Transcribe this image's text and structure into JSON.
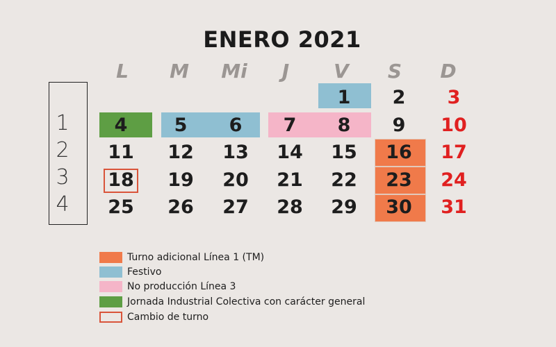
{
  "title": "ENERO 2021",
  "day_headers": [
    "L",
    "M",
    "Mi",
    "J",
    "V",
    "S",
    "D"
  ],
  "week_numbers": [
    "1",
    "2",
    "3",
    "4"
  ],
  "rows": [
    [
      "",
      "",
      "",
      "",
      "1",
      "2",
      "3"
    ],
    [
      "4",
      "5",
      "6",
      "7",
      "8",
      "9",
      "10"
    ],
    [
      "11",
      "12",
      "13",
      "14",
      "15",
      "16",
      "17"
    ],
    [
      "18",
      "19",
      "20",
      "21",
      "22",
      "23",
      "24"
    ],
    [
      "25",
      "26",
      "27",
      "28",
      "29",
      "30",
      "31"
    ]
  ],
  "legend": [
    {
      "label": "Turno adicional Línea 1 (TM)",
      "color": "#f07a4a"
    },
    {
      "label": "Festivo",
      "color": "#8fbfd2"
    },
    {
      "label": "No producción Línea 3",
      "color": "#f5b5c8"
    },
    {
      "label": "Jornada Industrial Colectiva con carácter general",
      "color": "#5e9e44"
    },
    {
      "label": "Cambio de turno",
      "color": "#d9543a"
    }
  ],
  "colors": {
    "weekend_sunday": "#e02020",
    "date_text": "#1d1d1d",
    "header_text": "#9b9693"
  }
}
